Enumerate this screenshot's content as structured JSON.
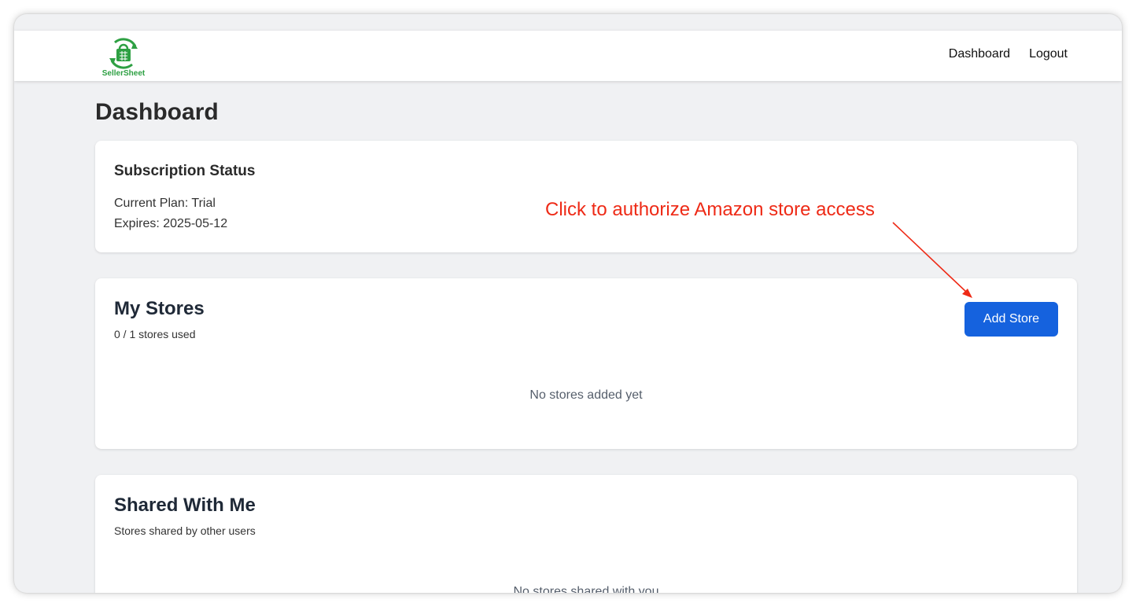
{
  "app": {
    "logo_text": "SellerSheet",
    "brand_color": "#2ea043"
  },
  "nav": {
    "links": [
      "Dashboard",
      "Logout"
    ]
  },
  "page": {
    "title": "Dashboard"
  },
  "subscription": {
    "title": "Subscription Status",
    "plan": "Current Plan: Trial",
    "expires": "Expires: 2025-05-12"
  },
  "stores": {
    "title": "My Stores",
    "usage": "0 / 1 stores used",
    "add_button": "Add Store",
    "empty": "No stores added yet",
    "button_color": "#1562de"
  },
  "shared": {
    "title": "Shared With Me",
    "subtitle": "Stores shared by other users",
    "empty": "No stores shared with you"
  },
  "annotation": {
    "text": "Click to authorize Amazon store access",
    "color": "#ee2a16"
  },
  "icons": {
    "logo": "shopping-bag-sync-icon",
    "arrow": "annotation-arrow-icon"
  }
}
